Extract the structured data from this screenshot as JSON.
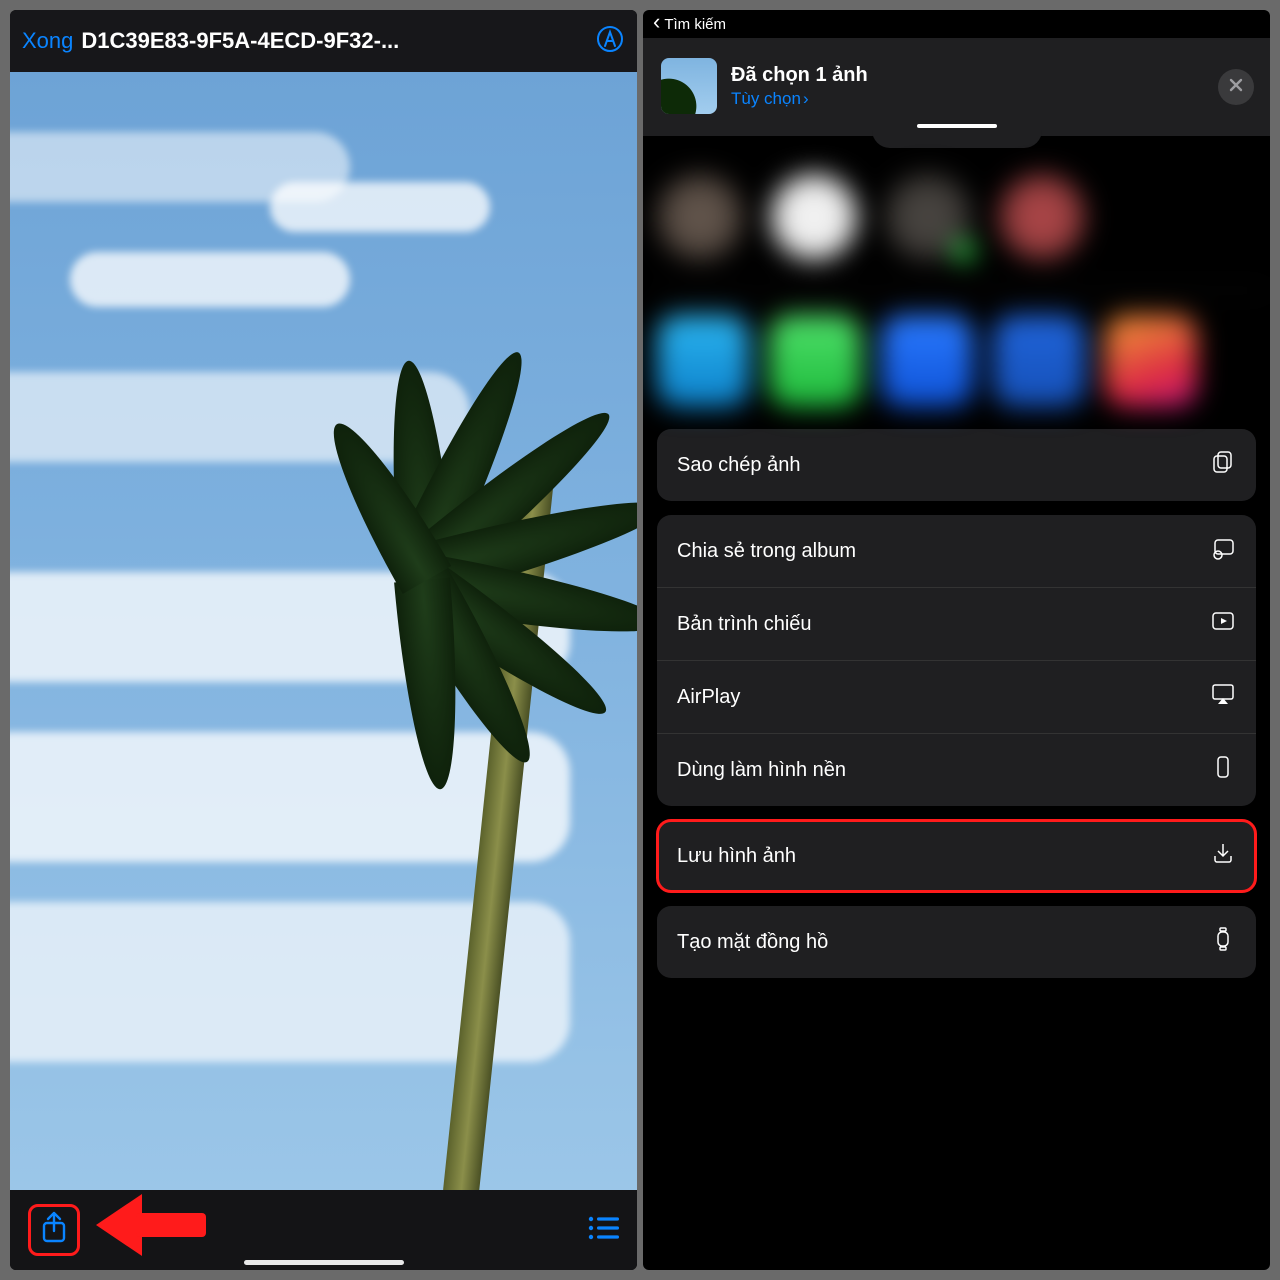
{
  "left": {
    "done": "Xong",
    "title": "D1C39E83-9F5A-4ECD-9F32-..."
  },
  "right": {
    "back": "Tìm kiếm",
    "selected_title": "Đã chọn 1 ảnh",
    "options": "Tùy chọn",
    "actions": {
      "copy": "Sao chép ảnh",
      "share_album": "Chia sẻ trong album",
      "slideshow": "Bản trình chiếu",
      "airplay": "AirPlay",
      "wallpaper": "Dùng làm hình nền",
      "save": "Lưu hình ảnh",
      "watchface": "Tạo mặt đồng hồ"
    }
  },
  "colors": {
    "accent": "#0a84ff",
    "danger": "#ff1b1b"
  }
}
